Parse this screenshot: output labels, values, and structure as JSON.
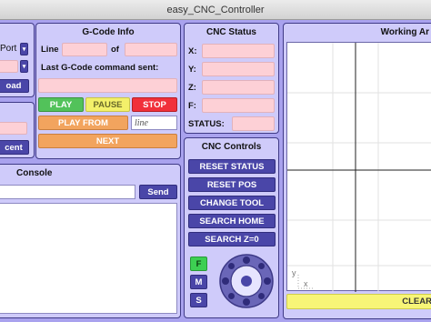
{
  "window": {
    "title": "easy_CNC_Controller"
  },
  "left_panel": {
    "port_label": "Port",
    "load_button": "oad",
    "recent_button": "cent"
  },
  "gcode_info": {
    "title": "G-Code Info",
    "line_label": "Line",
    "of_label": "of",
    "last_cmd_label": "Last G-Code command sent:",
    "play": "PLAY",
    "pause": "PAUSE",
    "stop": "STOP",
    "play_from": "PLAY FROM",
    "line_placeholder": "line",
    "next": "NEXT"
  },
  "cnc_status": {
    "title": "CNC Status",
    "x_label": "X:",
    "y_label": "Y:",
    "z_label": "Z:",
    "f_label": "F:",
    "status_label": "STATUS:"
  },
  "working_area": {
    "title": "Working Ar",
    "axis_y": "y",
    "axis_x": "x",
    "clear": "CLEAR"
  },
  "console": {
    "title": "Console",
    "send": "Send"
  },
  "cnc_controls": {
    "title": "CNC Controls",
    "reset_status": "RESET STATUS",
    "reset_pos": "RESET POS",
    "change_tool": "CHANGE TOOL",
    "search_home": "SEARCH HOME",
    "search_z0": "SEARCH Z=0",
    "step_f": "F",
    "step_m": "M",
    "step_s": "S"
  },
  "colors": {
    "panel_bg": "#cfcbfa",
    "field_pink": "#fdd0d6",
    "button_blue": "#4a46a8",
    "play_green": "#52c25a",
    "pause_yellow": "#f3f06a",
    "stop_red": "#f1303a",
    "orange": "#f2a45e",
    "clear_yellow": "#f7f577"
  },
  "icons": {
    "jog_pad": "directional-pad-icon"
  }
}
